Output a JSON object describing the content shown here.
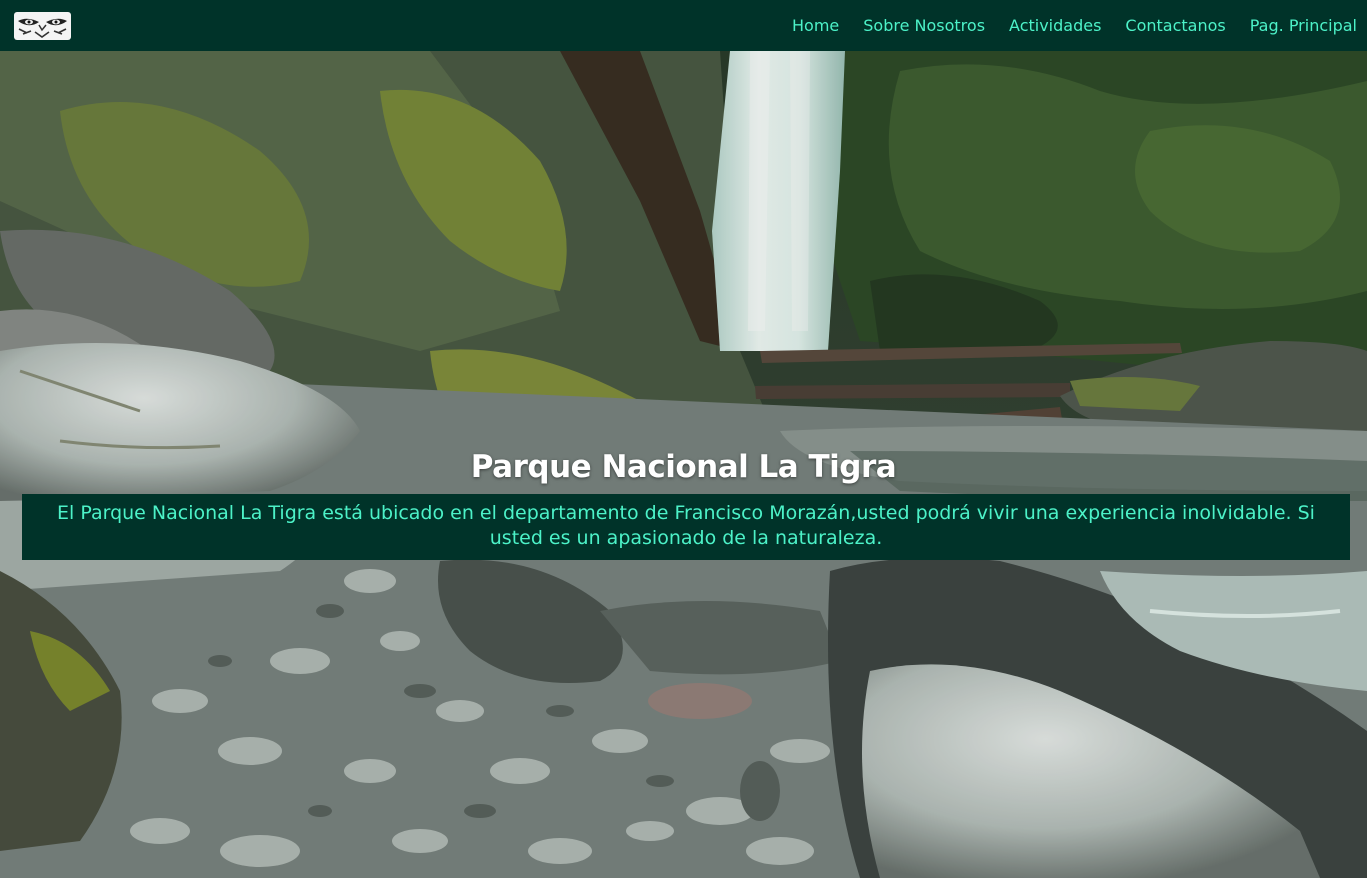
{
  "header": {
    "logo": {
      "icon": "tiger-eyes-logo-icon"
    },
    "nav": [
      {
        "label": "Home"
      },
      {
        "label": "Sobre Nosotros"
      },
      {
        "label": "Actividades"
      },
      {
        "label": "Contactanos"
      },
      {
        "label": "Pag. Principal"
      }
    ]
  },
  "hero": {
    "title": "Parque Nacional La Tigra",
    "description": "El Parque Nacional La Tigra está ubicado en el departamento de Francisco Morazán,usted podrá vivir una experiencia inolvidable. Si usted es un apasionado de la naturaleza."
  },
  "colors": {
    "navbar_bg": "#003329",
    "accent_text": "#4cf2c8",
    "title_text": "#ffffff"
  }
}
